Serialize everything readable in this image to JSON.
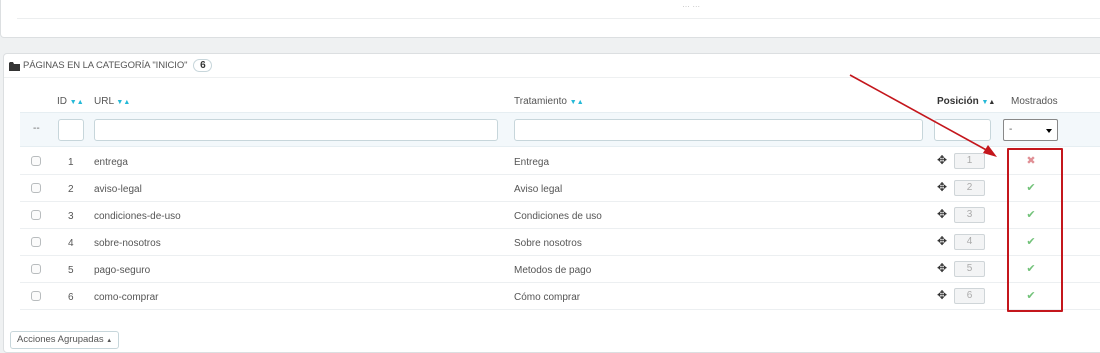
{
  "top_panel": {
    "partial_text": "… …"
  },
  "panel": {
    "heading": "Páginas en la categoría \"Inicio\"",
    "count": "6"
  },
  "columns": {
    "id": "ID",
    "url": "URL",
    "tratamiento": "Tratamiento",
    "posicion": "Posición",
    "mostrados": "Mostrados"
  },
  "filters": {
    "row_marker": "--",
    "mostrados_selected": "-"
  },
  "rows": [
    {
      "id": "1",
      "url": "entrega",
      "tratamiento": "Entrega",
      "posicion": "1",
      "mostrado": "no"
    },
    {
      "id": "2",
      "url": "aviso-legal",
      "tratamiento": "Aviso legal",
      "posicion": "2",
      "mostrado": "yes"
    },
    {
      "id": "3",
      "url": "condiciones-de-uso",
      "tratamiento": "Condiciones de uso",
      "posicion": "3",
      "mostrado": "yes"
    },
    {
      "id": "4",
      "url": "sobre-nosotros",
      "tratamiento": "Sobre nosotros",
      "posicion": "4",
      "mostrado": "yes"
    },
    {
      "id": "5",
      "url": "pago-seguro",
      "tratamiento": "Metodos de pago",
      "posicion": "5",
      "mostrado": "yes"
    },
    {
      "id": "6",
      "url": "como-comprar",
      "tratamiento": "Cómo comprar",
      "posicion": "6",
      "mostrado": "yes"
    }
  ],
  "bulk_actions": {
    "label": "Acciones Agrupadas"
  },
  "icons": {
    "folder": "folder-icon",
    "move": "move-icon",
    "enabled": "check-icon",
    "disabled": "cross-icon",
    "sort": "sort-arrows-icon"
  },
  "colors": {
    "accent": "#25b9d7",
    "enabled": "#72c279",
    "disabled": "#e08f95",
    "annotation": "#c4161c"
  }
}
